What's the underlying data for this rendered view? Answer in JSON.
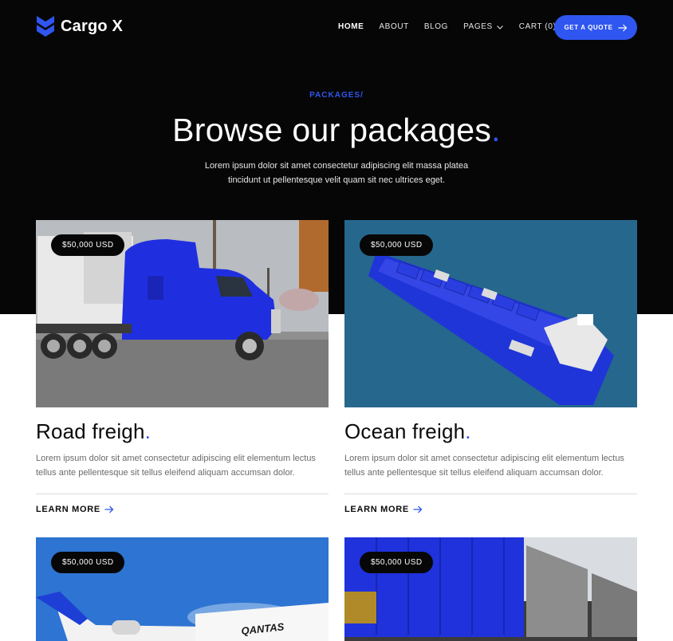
{
  "brand": {
    "name": "Cargo X",
    "accent": "#2f56f0"
  },
  "nav": {
    "items": [
      {
        "label": "HOME"
      },
      {
        "label": "ABOUT"
      },
      {
        "label": "BLOG"
      },
      {
        "label": "PAGES"
      },
      {
        "label": "CART (0)"
      }
    ],
    "cta": "GET A QUOTE"
  },
  "hero": {
    "eyebrow": "PACKAGES/",
    "title": "Browse our packages",
    "title_dot": ".",
    "description": "Lorem ipsum dolor sit amet consectetur adipiscing elit massa platea tincidunt ut pellentesque velit quam sit nec ultrices eget."
  },
  "cards": [
    {
      "price": "$50,000 USD",
      "title": "Road freigh",
      "dot": ".",
      "description": "Lorem ipsum dolor sit amet consectetur adipiscing elit elementum lectus tellus ante pellentesque sit tellus eleifend aliquam accumsan dolor.",
      "link": "LEARN MORE"
    },
    {
      "price": "$50,000 USD",
      "title": "Ocean freigh",
      "dot": ".",
      "description": "Lorem ipsum dolor sit amet consectetur adipiscing elit elementum lectus tellus ante pellentesque sit tellus eleifend aliquam accumsan dolor.",
      "link": "LEARN MORE"
    },
    {
      "price": "$50,000 USD",
      "plane_text": "QANTAS"
    },
    {
      "price": "$50,000 USD"
    }
  ]
}
